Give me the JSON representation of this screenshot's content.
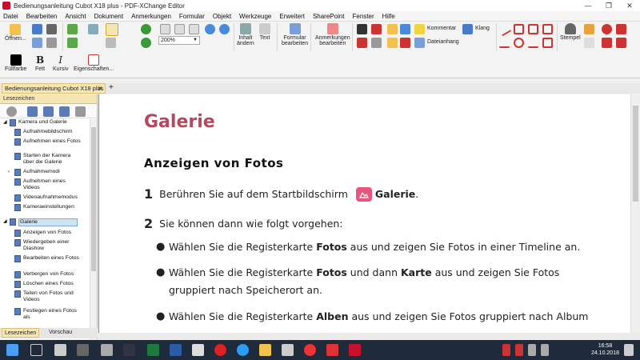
{
  "window": {
    "title": "Bedienungsanleitung Cubot X18 plus - PDF-XChange Editor",
    "minimize": "—",
    "maximize": "❐",
    "close": "✕"
  },
  "menu": [
    "Datei",
    "Bearbeiten",
    "Ansicht",
    "Dokument",
    "Anmerkungen",
    "Formular",
    "Objekt",
    "Werkzeuge",
    "Erweitert",
    "SharePoint",
    "Fenster",
    "Hilfe"
  ],
  "toolbar": {
    "open_label": "Öffnen...",
    "zoom_value": "200%",
    "inhalt_label": "Inhalt",
    "aendern_label": "ändern",
    "text_label": "Text",
    "formular_label": "Formular",
    "formular_sub": "bearbeiten",
    "anmerkungen_label": "Anmerkungen",
    "anmerkungen_sub": "bearbeiten",
    "kommentar_label": "Kommentar",
    "klang_label": "Klang",
    "dateianhang_label": "Dateianhang",
    "stempel_label": "Stempel",
    "fuellfarbe_label": "Füllfarbe",
    "fett_label": "Fett",
    "kursiv_label": "Kursiv",
    "eigenschaften_label": "Eigenschaften...",
    "fett_glyph": "B",
    "kursiv_glyph": "I"
  },
  "tab": {
    "label": "Bedienungsanleitung Cubot X18 plus",
    "close": "✕",
    "add": "+"
  },
  "sidebar": {
    "header": "Lesezeichen",
    "items": [
      {
        "label": "Kamera und Galerie",
        "level": 0,
        "expand": "◢"
      },
      {
        "label": "Aufnahmebildschirm",
        "level": 1
      },
      {
        "label": "Aufnehmen eines Fotos",
        "level": 1
      },
      {
        "label": "Starten der Kamera über die Galerie",
        "level": 1
      },
      {
        "label": "Aufnahmemodi",
        "level": 1,
        "expand": "›"
      },
      {
        "label": "Aufnehmen eines Videos",
        "level": 1
      },
      {
        "label": "Videoaufnahmemodus",
        "level": 1
      },
      {
        "label": "Kameraeinstellungen",
        "level": 1
      },
      {
        "label": "Galerie",
        "level": 0,
        "expand": "◢",
        "selected": true
      },
      {
        "label": "Anzeigen von Fotos",
        "level": 1
      },
      {
        "label": "Wiedergeben einer Diashow",
        "level": 1
      },
      {
        "label": "Bearbeiten eines Fotos",
        "level": 1
      },
      {
        "label": "Verbergen von Fotos",
        "level": 1
      },
      {
        "label": "Löschen eines Fotos",
        "level": 1
      },
      {
        "label": "Teilen von Fotos und Videos",
        "level": 1
      },
      {
        "label": "Festlegen eines Fotos als",
        "level": 1
      }
    ],
    "tab_bookmarks": "Lesezeichen",
    "tab_preview": "Vorschau"
  },
  "document": {
    "heading": "Galerie",
    "subheading": "Anzeigen von Fotos",
    "step1_num": "1",
    "step1_text": "Berühren Sie auf dem Startbildschirm",
    "step1_bold": "Galerie",
    "step1_end": ".",
    "step2_num": "2",
    "step2_text": "Sie können dann wie folgt vorgehen:",
    "bullet_glyph": "●",
    "bullet1": {
      "a": "Wählen Sie die Registerkarte ",
      "b": "Fotos",
      "c": " aus und zeigen Sie Fotos in einer Timeline an."
    },
    "bullet2": {
      "a": "Wählen Sie die Registerkarte ",
      "b": "Fotos",
      "c": " und dann ",
      "d": "Karte",
      "e": " aus und zeigen Sie Fotos gruppiert nach Speicherort an."
    },
    "bullet3": {
      "a": "Wählen Sie die Registerkarte ",
      "b": "Alben",
      "c": " aus und zeigen Sie Fotos gruppiert nach Album"
    }
  },
  "taskbar": {
    "time": "16:58",
    "date": "24.10.2018"
  },
  "colors": {
    "heading": "#b5485c",
    "tab_active": "#f6e6b2",
    "taskbar": "#1f2a3a"
  }
}
